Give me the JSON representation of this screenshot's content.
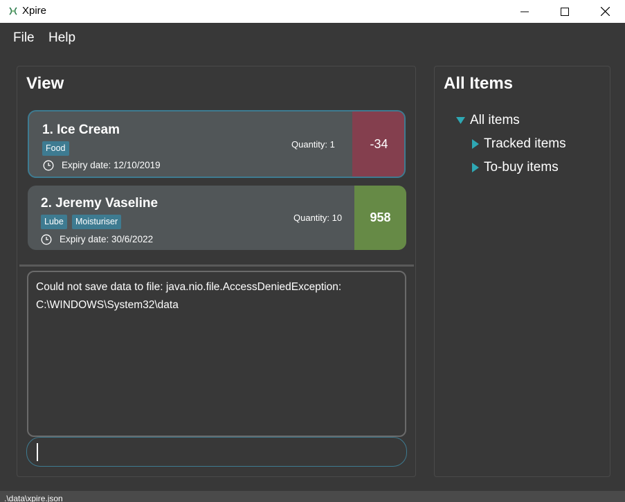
{
  "window": {
    "title": "Xpire",
    "icon": "xpire-logo-icon"
  },
  "menu": {
    "items": [
      {
        "label": "File"
      },
      {
        "label": "Help"
      }
    ]
  },
  "view_panel": {
    "title": "View",
    "items": [
      {
        "index_name": "1.  Ice Cream",
        "tags": [
          "Food"
        ],
        "expiry": "Expiry date: 12/10/2019",
        "quantity": "Quantity: 1",
        "days": "-34",
        "days_color": "#843f4e",
        "selected": true
      },
      {
        "index_name": "2.  Jeremy Vaseline",
        "tags": [
          "Lube",
          "Moisturiser"
        ],
        "expiry": "Expiry date: 30/6/2022",
        "quantity": "Quantity: 10",
        "days": "958",
        "days_color": "#668a46",
        "selected": false
      }
    ]
  },
  "result_display": {
    "line1": "Could not save data to file: java.nio.file.AccessDeniedException:",
    "line2": "C:\\WINDOWS\\System32\\data"
  },
  "command_box": {
    "value": ""
  },
  "all_items_panel": {
    "title": "All Items",
    "tree": {
      "root": "All items",
      "children": [
        "Tracked items",
        "To-buy items"
      ]
    }
  },
  "status_bar": {
    "path": ".\\data\\xpire.json"
  },
  "colors": {
    "accent": "#3e7b91",
    "background": "#383838",
    "card": "#515658",
    "expired": "#843f4e",
    "fresh": "#668a46"
  }
}
